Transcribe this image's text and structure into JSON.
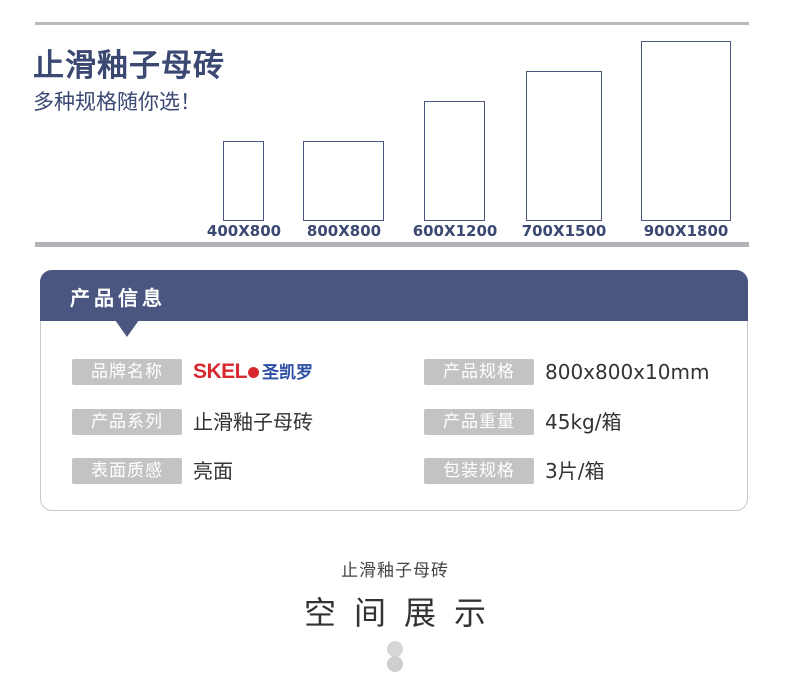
{
  "hero": {
    "title": "止滑釉子母砖",
    "subtitle": "多种规格随你选！"
  },
  "sizes": [
    {
      "label": "400X800"
    },
    {
      "label": "800X800"
    },
    {
      "label": "600X1200"
    },
    {
      "label": "700X1500"
    },
    {
      "label": "900X1800"
    }
  ],
  "product_info": {
    "heading": "产品信息",
    "rows": [
      {
        "label": "品牌名称",
        "value": ""
      },
      {
        "label": "产品规格",
        "value": "800x800x10mm"
      },
      {
        "label": "产品系列",
        "value": "止滑釉子母砖"
      },
      {
        "label": "产品重量",
        "value": "45kg/箱"
      },
      {
        "label": "表面质感",
        "value": "亮面"
      },
      {
        "label": "包装规格",
        "value": "3片/箱"
      }
    ],
    "brand": {
      "en": "SKEL",
      "cn": "圣凯罗"
    }
  },
  "footer": {
    "small": "止滑釉子母砖",
    "big": "空间展示"
  },
  "colors": {
    "accent": "#4b5680",
    "title": "#3a4872",
    "pill": "#c3c3c6",
    "brand_red": "#d8282f",
    "brand_blue": "#2d4fa3"
  },
  "icons": {
    "scroll": "scroll-indicator-icon"
  }
}
